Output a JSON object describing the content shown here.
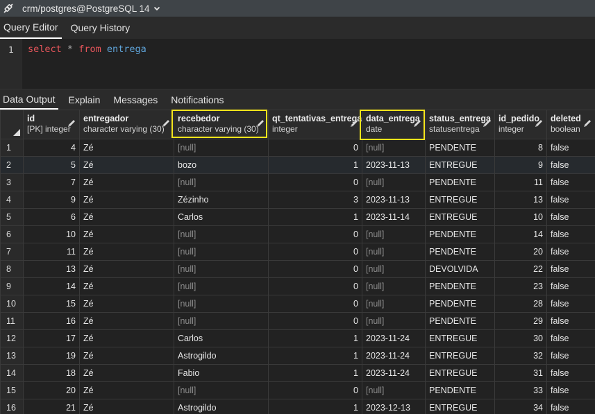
{
  "connection": {
    "label": "crm/postgres@PostgreSQL 14",
    "icon": "plug-icon"
  },
  "editor_tabs": [
    {
      "label": "Query Editor",
      "active": true
    },
    {
      "label": "Query History",
      "active": false
    }
  ],
  "editor": {
    "line_number": "1",
    "keyword_select": "select",
    "operator": "*",
    "keyword_from": "from",
    "table_name": "entrega"
  },
  "output_tabs": [
    {
      "label": "Data Output",
      "active": true
    },
    {
      "label": "Explain",
      "active": false
    },
    {
      "label": "Messages",
      "active": false
    },
    {
      "label": "Notifications",
      "active": false
    }
  ],
  "colors": {
    "highlight": "#f5e51b",
    "keyword": "#e8565b",
    "table": "#5fa4d9",
    "null_text": "#8b8b8b"
  },
  "columns": [
    {
      "name": "id",
      "type": "[PK] integer"
    },
    {
      "name": "entregador",
      "type": "character varying (30)"
    },
    {
      "name": "recebedor",
      "type": "character varying (30)"
    },
    {
      "name": "qt_tentativas_entrega",
      "type": "integer"
    },
    {
      "name": "data_entrega",
      "type": "date"
    },
    {
      "name": "status_entrega",
      "type": "statusentrega"
    },
    {
      "name": "id_pedido",
      "type": "integer"
    },
    {
      "name": "deleted",
      "type": "boolean"
    }
  ],
  "rows": [
    {
      "n": "1",
      "id": "4",
      "entregador": "Zé",
      "recebedor": "[null]",
      "qt": "0",
      "data": "[null]",
      "status": "PENDENTE",
      "pedido": "8",
      "deleted": "false"
    },
    {
      "n": "2",
      "id": "5",
      "entregador": "Zé",
      "recebedor": "bozo",
      "qt": "1",
      "data": "2023-11-13",
      "status": "ENTREGUE",
      "pedido": "9",
      "deleted": "false"
    },
    {
      "n": "3",
      "id": "7",
      "entregador": "Zé",
      "recebedor": "[null]",
      "qt": "0",
      "data": "[null]",
      "status": "PENDENTE",
      "pedido": "11",
      "deleted": "false"
    },
    {
      "n": "4",
      "id": "9",
      "entregador": "Zé",
      "recebedor": "Zézinho",
      "qt": "3",
      "data": "2023-11-13",
      "status": "ENTREGUE",
      "pedido": "13",
      "deleted": "false"
    },
    {
      "n": "5",
      "id": "6",
      "entregador": "Zé",
      "recebedor": "Carlos",
      "qt": "1",
      "data": "2023-11-14",
      "status": "ENTREGUE",
      "pedido": "10",
      "deleted": "false"
    },
    {
      "n": "6",
      "id": "10",
      "entregador": "Zé",
      "recebedor": "[null]",
      "qt": "0",
      "data": "[null]",
      "status": "PENDENTE",
      "pedido": "14",
      "deleted": "false"
    },
    {
      "n": "7",
      "id": "11",
      "entregador": "Zé",
      "recebedor": "[null]",
      "qt": "0",
      "data": "[null]",
      "status": "PENDENTE",
      "pedido": "20",
      "deleted": "false"
    },
    {
      "n": "8",
      "id": "13",
      "entregador": "Zé",
      "recebedor": "[null]",
      "qt": "0",
      "data": "[null]",
      "status": "DEVOLVIDA",
      "pedido": "22",
      "deleted": "false"
    },
    {
      "n": "9",
      "id": "14",
      "entregador": "Zé",
      "recebedor": "[null]",
      "qt": "0",
      "data": "[null]",
      "status": "PENDENTE",
      "pedido": "23",
      "deleted": "false"
    },
    {
      "n": "10",
      "id": "15",
      "entregador": "Zé",
      "recebedor": "[null]",
      "qt": "0",
      "data": "[null]",
      "status": "PENDENTE",
      "pedido": "28",
      "deleted": "false"
    },
    {
      "n": "11",
      "id": "16",
      "entregador": "Zé",
      "recebedor": "[null]",
      "qt": "0",
      "data": "[null]",
      "status": "PENDENTE",
      "pedido": "29",
      "deleted": "false"
    },
    {
      "n": "12",
      "id": "17",
      "entregador": "Zé",
      "recebedor": "Carlos",
      "qt": "1",
      "data": "2023-11-24",
      "status": "ENTREGUE",
      "pedido": "30",
      "deleted": "false"
    },
    {
      "n": "13",
      "id": "19",
      "entregador": "Zé",
      "recebedor": "Astrogildo",
      "qt": "1",
      "data": "2023-11-24",
      "status": "ENTREGUE",
      "pedido": "32",
      "deleted": "false"
    },
    {
      "n": "14",
      "id": "18",
      "entregador": "Zé",
      "recebedor": "Fabio",
      "qt": "1",
      "data": "2023-11-24",
      "status": "ENTREGUE",
      "pedido": "31",
      "deleted": "false"
    },
    {
      "n": "15",
      "id": "20",
      "entregador": "Zé",
      "recebedor": "[null]",
      "qt": "0",
      "data": "[null]",
      "status": "PENDENTE",
      "pedido": "33",
      "deleted": "false"
    },
    {
      "n": "16",
      "id": "21",
      "entregador": "Zé",
      "recebedor": "Astrogildo",
      "qt": "1",
      "data": "2023-12-13",
      "status": "ENTREGUE",
      "pedido": "34",
      "deleted": "false"
    }
  ]
}
